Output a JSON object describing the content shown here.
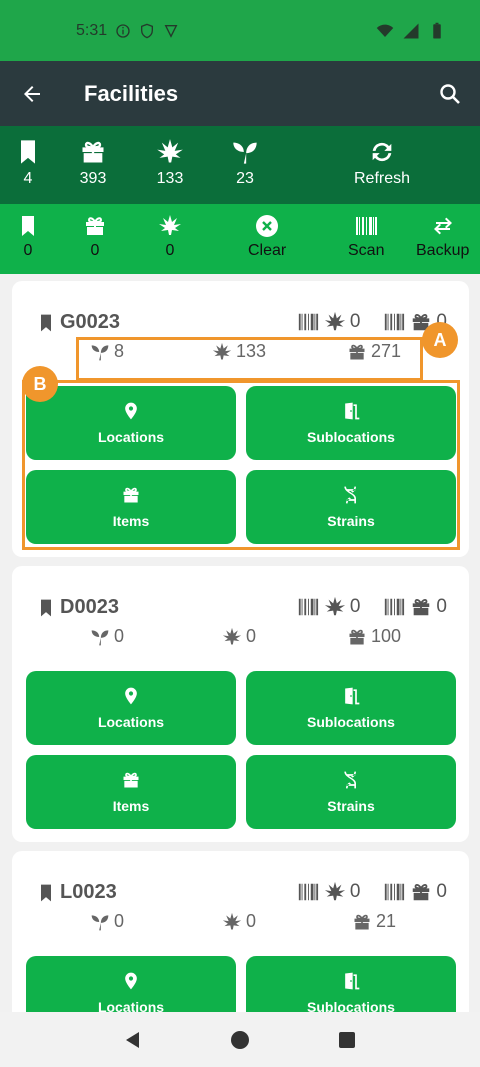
{
  "status_bar": {
    "time": "5:31"
  },
  "app_bar": {
    "title": "Facilities"
  },
  "stats": {
    "bookmarks": "4",
    "items": "393",
    "plants": "133",
    "seedlings": "23",
    "refresh_label": "Refresh"
  },
  "selection": {
    "bookmarks": "0",
    "items": "0",
    "plants": "0",
    "clear_label": "Clear",
    "scan_label": "Scan",
    "backup_label": "Backup"
  },
  "cards": [
    {
      "code": "G0023",
      "barcode_plants": "0",
      "barcode_items": "0",
      "seedlings": "8",
      "plants": "133",
      "items": "271",
      "buttons": {
        "locations": "Locations",
        "sublocations": "Sublocations",
        "items": "Items",
        "strains": "Strains"
      }
    },
    {
      "code": "D0023",
      "barcode_plants": "0",
      "barcode_items": "0",
      "seedlings": "0",
      "plants": "0",
      "items": "100",
      "buttons": {
        "locations": "Locations",
        "sublocations": "Sublocations",
        "items": "Items",
        "strains": "Strains"
      }
    },
    {
      "code": "L0023",
      "barcode_plants": "0",
      "barcode_items": "0",
      "seedlings": "0",
      "plants": "0",
      "items": "21",
      "buttons": {
        "locations": "Locations",
        "sublocations": "Sublocations"
      }
    }
  ],
  "annotations": {
    "a": "A",
    "b": "B",
    "color": "#f0962c"
  },
  "colors": {
    "primary": "#0fb14a",
    "dark_green": "#0b6e3a",
    "app_bar": "#2b3a3e"
  }
}
